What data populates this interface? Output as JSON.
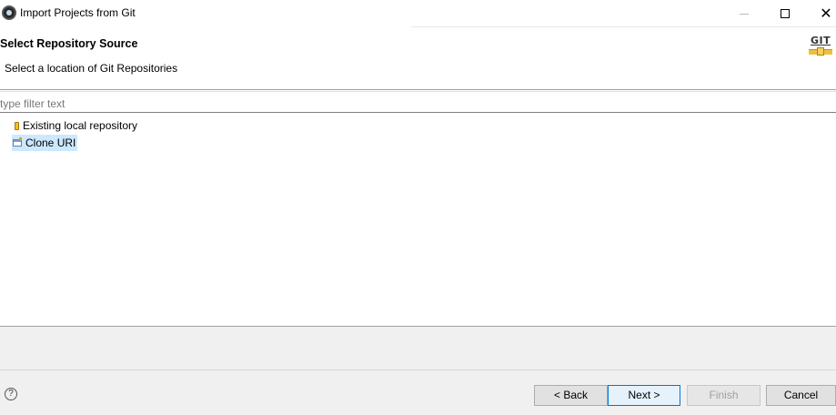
{
  "window": {
    "title": "Import Projects from Git",
    "minimize_icon": "minimize-icon",
    "maximize_icon": "maximize-icon",
    "close_icon": "close-icon",
    "close_glyph": "✕"
  },
  "header": {
    "title": "Select Repository Source",
    "description": "Select a location of Git Repositories",
    "logo_text": "GIT"
  },
  "filter": {
    "placeholder": "type filter text",
    "value": ""
  },
  "tree": {
    "items": [
      {
        "label": "Existing local repository",
        "icon": "repository-icon",
        "selected": false
      },
      {
        "label": "Clone URI",
        "icon": "clone-uri-icon",
        "selected": true
      }
    ]
  },
  "footer": {
    "help_glyph": "?",
    "back_label": "< Back",
    "next_label": "Next >",
    "finish_label": "Finish",
    "cancel_label": "Cancel",
    "finish_enabled": false
  },
  "colors": {
    "selection": "#cce8ff",
    "default_button_border": "#0078d7",
    "dialog_background": "#f0f0f0"
  }
}
